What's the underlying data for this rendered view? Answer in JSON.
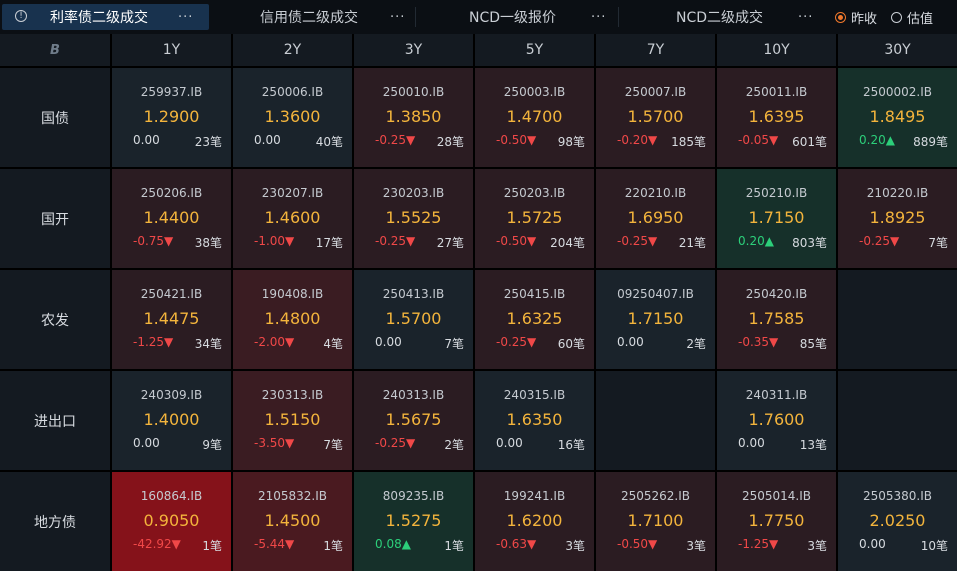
{
  "tabs": [
    {
      "label": "利率债二级成交",
      "more": "···",
      "active": true
    },
    {
      "label": "信用债二级成交",
      "more": "···",
      "active": false
    },
    {
      "label": "NCD一级报价",
      "more": "···",
      "active": false
    },
    {
      "label": "NCD二级成交",
      "more": "···",
      "active": false
    }
  ],
  "radios": [
    {
      "label": "昨收",
      "checked": true
    },
    {
      "label": "估值",
      "checked": false
    }
  ],
  "corner_icon": "B",
  "tenors": [
    "1Y",
    "2Y",
    "3Y",
    "5Y",
    "7Y",
    "10Y",
    "30Y"
  ],
  "rows": [
    {
      "name": "国债",
      "cells": [
        {
          "code": "259937.IB",
          "yield": "1.2900",
          "chg": "0.00",
          "dir": "flat",
          "count": "23笔",
          "bg": "#1a232b"
        },
        {
          "code": "250006.IB",
          "yield": "1.3600",
          "chg": "0.00",
          "dir": "flat",
          "count": "40笔",
          "bg": "#1a232b"
        },
        {
          "code": "250010.IB",
          "yield": "1.3850",
          "chg": "-0.25▼",
          "dir": "down",
          "count": "28笔",
          "bg": "#2b1c22"
        },
        {
          "code": "250003.IB",
          "yield": "1.4700",
          "chg": "-0.50▼",
          "dir": "down",
          "count": "98笔",
          "bg": "#2b1c22"
        },
        {
          "code": "250007.IB",
          "yield": "1.5700",
          "chg": "-0.20▼",
          "dir": "down",
          "count": "185笔",
          "bg": "#2b1c22"
        },
        {
          "code": "250011.IB",
          "yield": "1.6395",
          "chg": "-0.05▼",
          "dir": "down",
          "count": "601笔",
          "bg": "#2b1c22"
        },
        {
          "code": "2500002.IB",
          "yield": "1.8495",
          "chg": "0.20▲",
          "dir": "up",
          "count": "889笔",
          "bg": "#16302a"
        }
      ]
    },
    {
      "name": "国开",
      "cells": [
        {
          "code": "250206.IB",
          "yield": "1.4400",
          "chg": "-0.75▼",
          "dir": "down",
          "count": "38笔",
          "bg": "#2b1c22"
        },
        {
          "code": "230207.IB",
          "yield": "1.4600",
          "chg": "-1.00▼",
          "dir": "down",
          "count": "17笔",
          "bg": "#2b1c22"
        },
        {
          "code": "230203.IB",
          "yield": "1.5525",
          "chg": "-0.25▼",
          "dir": "down",
          "count": "27笔",
          "bg": "#2b1c22"
        },
        {
          "code": "250203.IB",
          "yield": "1.5725",
          "chg": "-0.50▼",
          "dir": "down",
          "count": "204笔",
          "bg": "#2b1c22"
        },
        {
          "code": "220210.IB",
          "yield": "1.6950",
          "chg": "-0.25▼",
          "dir": "down",
          "count": "21笔",
          "bg": "#2b1c22"
        },
        {
          "code": "250210.IB",
          "yield": "1.7150",
          "chg": "0.20▲",
          "dir": "up",
          "count": "803笔",
          "bg": "#16302a"
        },
        {
          "code": "210220.IB",
          "yield": "1.8925",
          "chg": "-0.25▼",
          "dir": "down",
          "count": "7笔",
          "bg": "#2b1c22"
        }
      ]
    },
    {
      "name": "农发",
      "cells": [
        {
          "code": "250421.IB",
          "yield": "1.4475",
          "chg": "-1.25▼",
          "dir": "down",
          "count": "34笔",
          "bg": "#2b1c22"
        },
        {
          "code": "190408.IB",
          "yield": "1.4800",
          "chg": "-2.00▼",
          "dir": "down",
          "count": "4笔",
          "bg": "#3a1c22"
        },
        {
          "code": "250413.IB",
          "yield": "1.5700",
          "chg": "0.00",
          "dir": "flat",
          "count": "7笔",
          "bg": "#1a232b"
        },
        {
          "code": "250415.IB",
          "yield": "1.6325",
          "chg": "-0.25▼",
          "dir": "down",
          "count": "60笔",
          "bg": "#2b1c22"
        },
        {
          "code": "09250407.IB",
          "yield": "1.7150",
          "chg": "0.00",
          "dir": "flat",
          "count": "2笔",
          "bg": "#1a232b"
        },
        {
          "code": "250420.IB",
          "yield": "1.7585",
          "chg": "-0.35▼",
          "dir": "down",
          "count": "85笔",
          "bg": "#2b1c22"
        },
        {
          "code": "",
          "yield": "",
          "chg": "",
          "dir": "flat",
          "count": "",
          "bg": "#141a21"
        }
      ]
    },
    {
      "name": "进出口",
      "cells": [
        {
          "code": "240309.IB",
          "yield": "1.4000",
          "chg": "0.00",
          "dir": "flat",
          "count": "9笔",
          "bg": "#1a232b"
        },
        {
          "code": "230313.IB",
          "yield": "1.5150",
          "chg": "-3.50▼",
          "dir": "down",
          "count": "7笔",
          "bg": "#3a1c22"
        },
        {
          "code": "240313.IB",
          "yield": "1.5675",
          "chg": "-0.25▼",
          "dir": "down",
          "count": "2笔",
          "bg": "#2b1c22"
        },
        {
          "code": "240315.IB",
          "yield": "1.6350",
          "chg": "0.00",
          "dir": "flat",
          "count": "16笔",
          "bg": "#1a232b"
        },
        {
          "code": "",
          "yield": "",
          "chg": "",
          "dir": "flat",
          "count": "",
          "bg": "#141a21"
        },
        {
          "code": "240311.IB",
          "yield": "1.7600",
          "chg": "0.00",
          "dir": "flat",
          "count": "13笔",
          "bg": "#1a232b"
        },
        {
          "code": "",
          "yield": "",
          "chg": "",
          "dir": "flat",
          "count": "",
          "bg": "#141a21"
        }
      ]
    },
    {
      "name": "地方债",
      "cells": [
        {
          "code": "160864.IB",
          "yield": "0.9050",
          "chg": "-42.92▼",
          "dir": "down",
          "count": "1笔",
          "bg": "#85121a"
        },
        {
          "code": "2105832.IB",
          "yield": "1.4500",
          "chg": "-5.44▼",
          "dir": "down",
          "count": "1笔",
          "bg": "#4a1a20"
        },
        {
          "code": "809235.IB",
          "yield": "1.5275",
          "chg": "0.08▲",
          "dir": "up",
          "count": "1笔",
          "bg": "#16302a"
        },
        {
          "code": "199241.IB",
          "yield": "1.6200",
          "chg": "-0.63▼",
          "dir": "down",
          "count": "3笔",
          "bg": "#2b1c22"
        },
        {
          "code": "2505262.IB",
          "yield": "1.7100",
          "chg": "-0.50▼",
          "dir": "down",
          "count": "3笔",
          "bg": "#2b1c22"
        },
        {
          "code": "2505014.IB",
          "yield": "1.7750",
          "chg": "-1.25▼",
          "dir": "down",
          "count": "3笔",
          "bg": "#2b1c22"
        },
        {
          "code": "2505380.IB",
          "yield": "2.0250",
          "chg": "0.00",
          "dir": "flat",
          "count": "10笔",
          "bg": "#1a232b"
        }
      ]
    }
  ]
}
